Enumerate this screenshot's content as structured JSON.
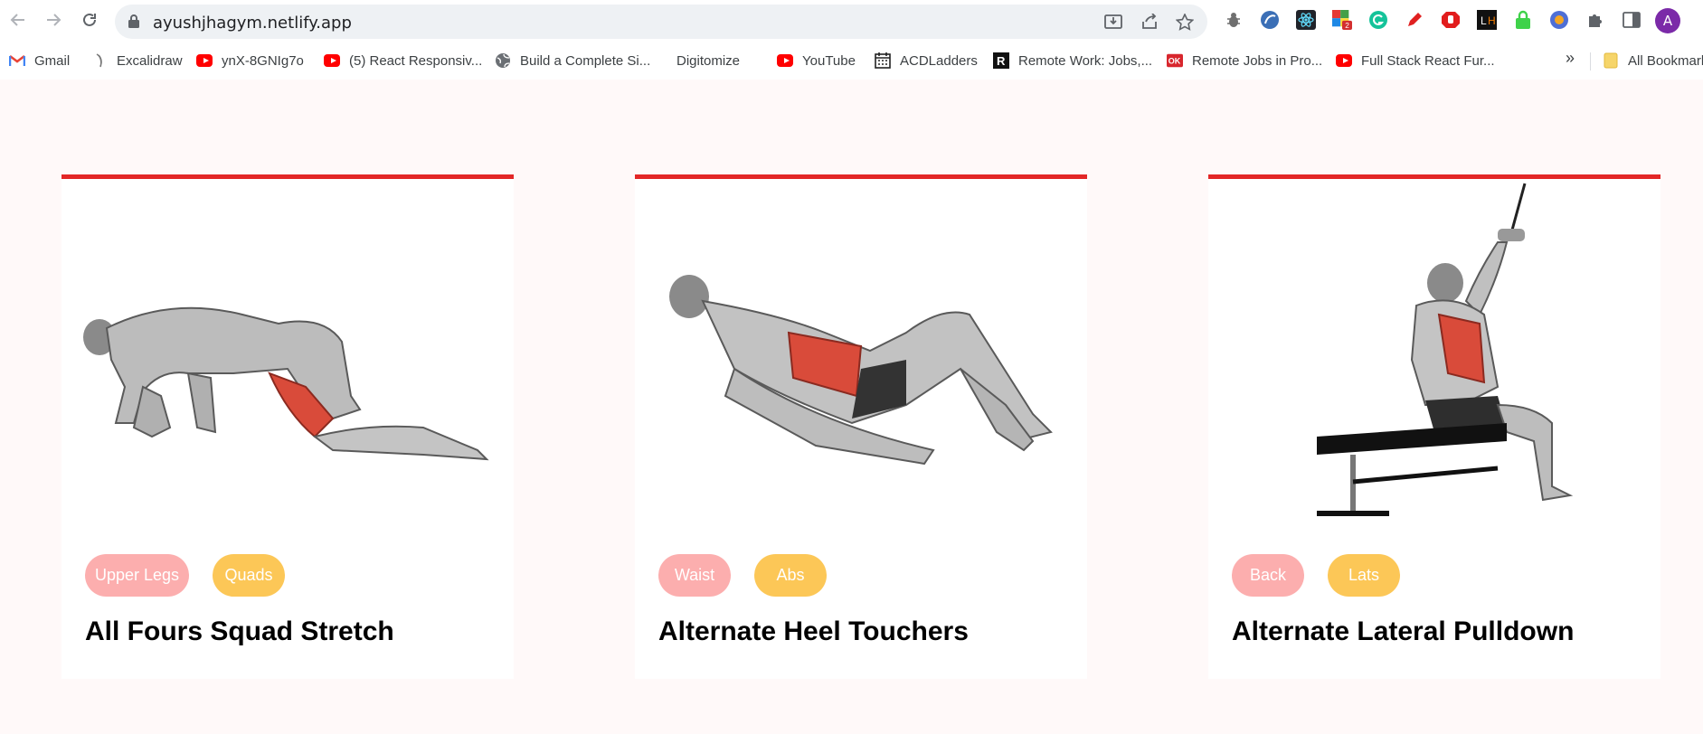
{
  "browser": {
    "url": "ayushjhagym.netlify.app",
    "avatar_letter": "A",
    "bookmarks": [
      {
        "label": "Gmail",
        "icon": "gmail-icon"
      },
      {
        "label": "Excalidraw",
        "icon": "excalidraw-icon"
      },
      {
        "label": "ynX-8GNIg7o",
        "icon": "youtube-icon"
      },
      {
        "label": "(5) React Responsiv...",
        "icon": "youtube-icon"
      },
      {
        "label": "Build a Complete Si...",
        "icon": "globe-icon"
      },
      {
        "label": "Digitomize",
        "icon": "digitomize-icon"
      },
      {
        "label": "YouTube",
        "icon": "youtube-icon"
      },
      {
        "label": "ACDLadders",
        "icon": "calendar-icon"
      },
      {
        "label": "Remote Work: Jobs,...",
        "icon": "remote-icon"
      },
      {
        "label": "Remote Jobs in Pro...",
        "icon": "ok-icon"
      },
      {
        "label": "Full Stack React Fur...",
        "icon": "youtube-icon"
      }
    ],
    "all_bookmarks_label": "All Bookmarks",
    "extension_badge": "2"
  },
  "colors": {
    "accent": "#e32727",
    "body_tag": "#fcaeae",
    "target_tag": "#fcc757",
    "page_bg": "#fff9f9"
  },
  "exercises": [
    {
      "name": "All Fours Squad Stretch",
      "body_part": "Upper Legs",
      "target": "Quads",
      "image": "kneeling-stretch-illustration"
    },
    {
      "name": "Alternate Heel Touchers",
      "body_part": "Waist",
      "target": "Abs",
      "image": "lying-heel-touch-illustration"
    },
    {
      "name": "Alternate Lateral Pulldown",
      "body_part": "Back",
      "target": "Lats",
      "image": "cable-pulldown-illustration"
    }
  ]
}
